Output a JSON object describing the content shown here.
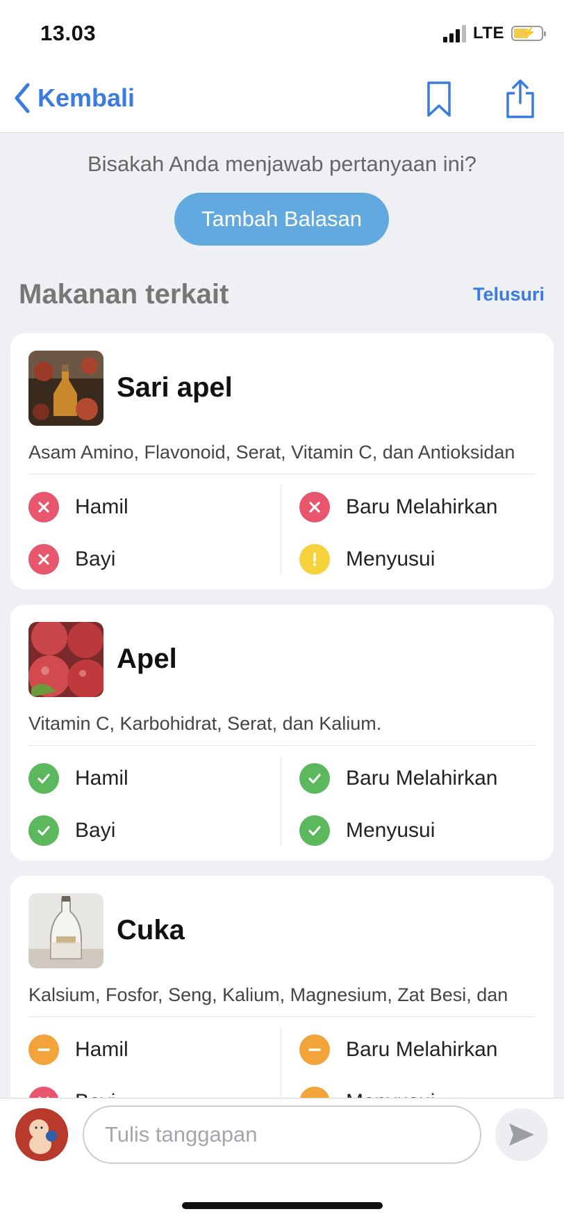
{
  "status_bar": {
    "time": "13.03",
    "network": "LTE"
  },
  "nav": {
    "back_label": "Kembali"
  },
  "prompt": {
    "question": "Bisakah Anda menjawab pertanyaan ini?",
    "button_label": "Tambah Balasan"
  },
  "related": {
    "title": "Makanan terkait",
    "link_label": "Telusuri",
    "cards": [
      {
        "name": "Sari apel",
        "nutrients": "Asam Amino, Flavonoid, Serat, Vitamin C, dan Antioksidan",
        "stats": [
          {
            "label": "Hamil",
            "status": "no"
          },
          {
            "label": "Baru Melahirkan",
            "status": "no"
          },
          {
            "label": "Bayi",
            "status": "no"
          },
          {
            "label": "Menyusui",
            "status": "caution"
          }
        ]
      },
      {
        "name": "Apel",
        "nutrients": "Vitamin C, Karbohidrat, Serat, dan Kalium.",
        "stats": [
          {
            "label": "Hamil",
            "status": "yes"
          },
          {
            "label": "Baru Melahirkan",
            "status": "yes"
          },
          {
            "label": "Bayi",
            "status": "yes"
          },
          {
            "label": "Menyusui",
            "status": "yes"
          }
        ]
      },
      {
        "name": "Cuka",
        "nutrients": "Kalsium, Fosfor, Seng, Kalium, Magnesium, Zat Besi, dan",
        "stats": [
          {
            "label": "Hamil",
            "status": "limited"
          },
          {
            "label": "Baru Melahirkan",
            "status": "limited"
          },
          {
            "label": "Bayi",
            "status": "no"
          },
          {
            "label": "Menyusui",
            "status": "limited"
          }
        ]
      }
    ]
  },
  "composer": {
    "placeholder": "Tulis tanggapan"
  },
  "colors": {
    "accent": "#3a7be0",
    "button": "#62a9e0",
    "no": "#e8566d",
    "yes": "#5cb85c",
    "caution": "#f5d23c",
    "limited": "#f2a33a"
  },
  "icons": {
    "no": "x-icon",
    "yes": "check-icon",
    "caution": "exclamation-icon",
    "limited": "minus-icon"
  }
}
